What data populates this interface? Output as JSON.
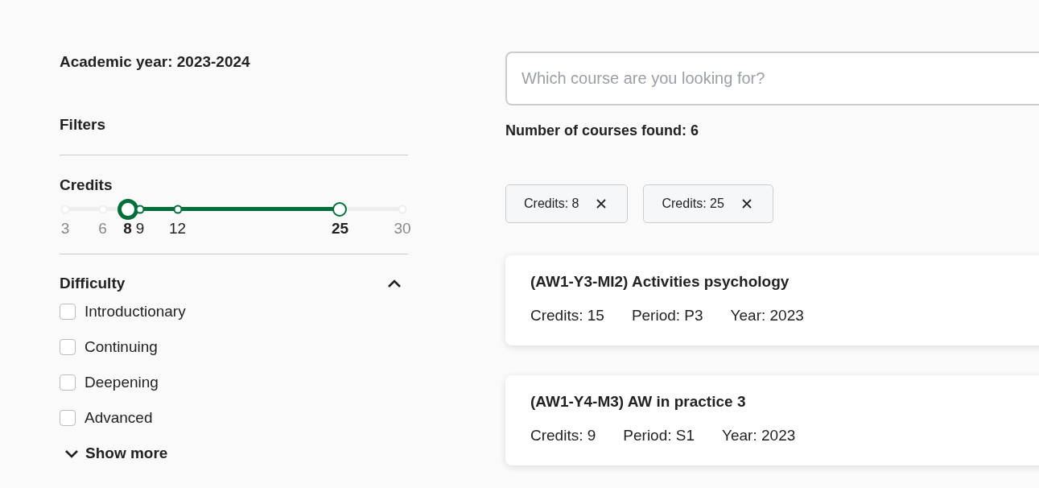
{
  "sidebar": {
    "academic_year": "Academic year: 2023-2024",
    "filters_title": "Filters",
    "credits": {
      "title": "Credits",
      "marks": [
        {
          "label": "3",
          "level": 0,
          "selected": false,
          "focused": false
        },
        {
          "label": "6",
          "level": 0.111,
          "selected": false,
          "focused": false
        },
        {
          "label": "8",
          "level": 0.185,
          "selected": true,
          "focused": true
        },
        {
          "label": "9",
          "level": 0.222,
          "selected": false,
          "focused": false
        },
        {
          "label": "12",
          "level": 0.333,
          "selected": false,
          "focused": false
        },
        {
          "label": "25",
          "level": 0.815,
          "selected": true,
          "focused": false
        },
        {
          "label": "30",
          "level": 1,
          "selected": false,
          "focused": false
        }
      ]
    },
    "difficulty": {
      "title": "Difficulty",
      "expanded": true,
      "options": [
        {
          "label": "Introductionary",
          "checked": false
        },
        {
          "label": "Continuing",
          "checked": false
        },
        {
          "label": "Deepening",
          "checked": false
        },
        {
          "label": "Advanced",
          "checked": false
        }
      ],
      "show_more": "Show more"
    }
  },
  "search": {
    "placeholder": "Which course are you looking for?"
  },
  "results_count": "Number of courses found: 6",
  "chips": [
    "Credits: 8",
    "Credits: 25"
  ],
  "courses": [
    {
      "title": "(AW1-Y3-MI2) Activities psychology",
      "credits": "Credits: 15",
      "period": "Period: P3",
      "year": "Year: 2023"
    },
    {
      "title": "(AW1-Y4-M3) AW in practice 3",
      "credits": "Credits: 9",
      "period": "Period: S1",
      "year": "Year: 2023"
    }
  ]
}
